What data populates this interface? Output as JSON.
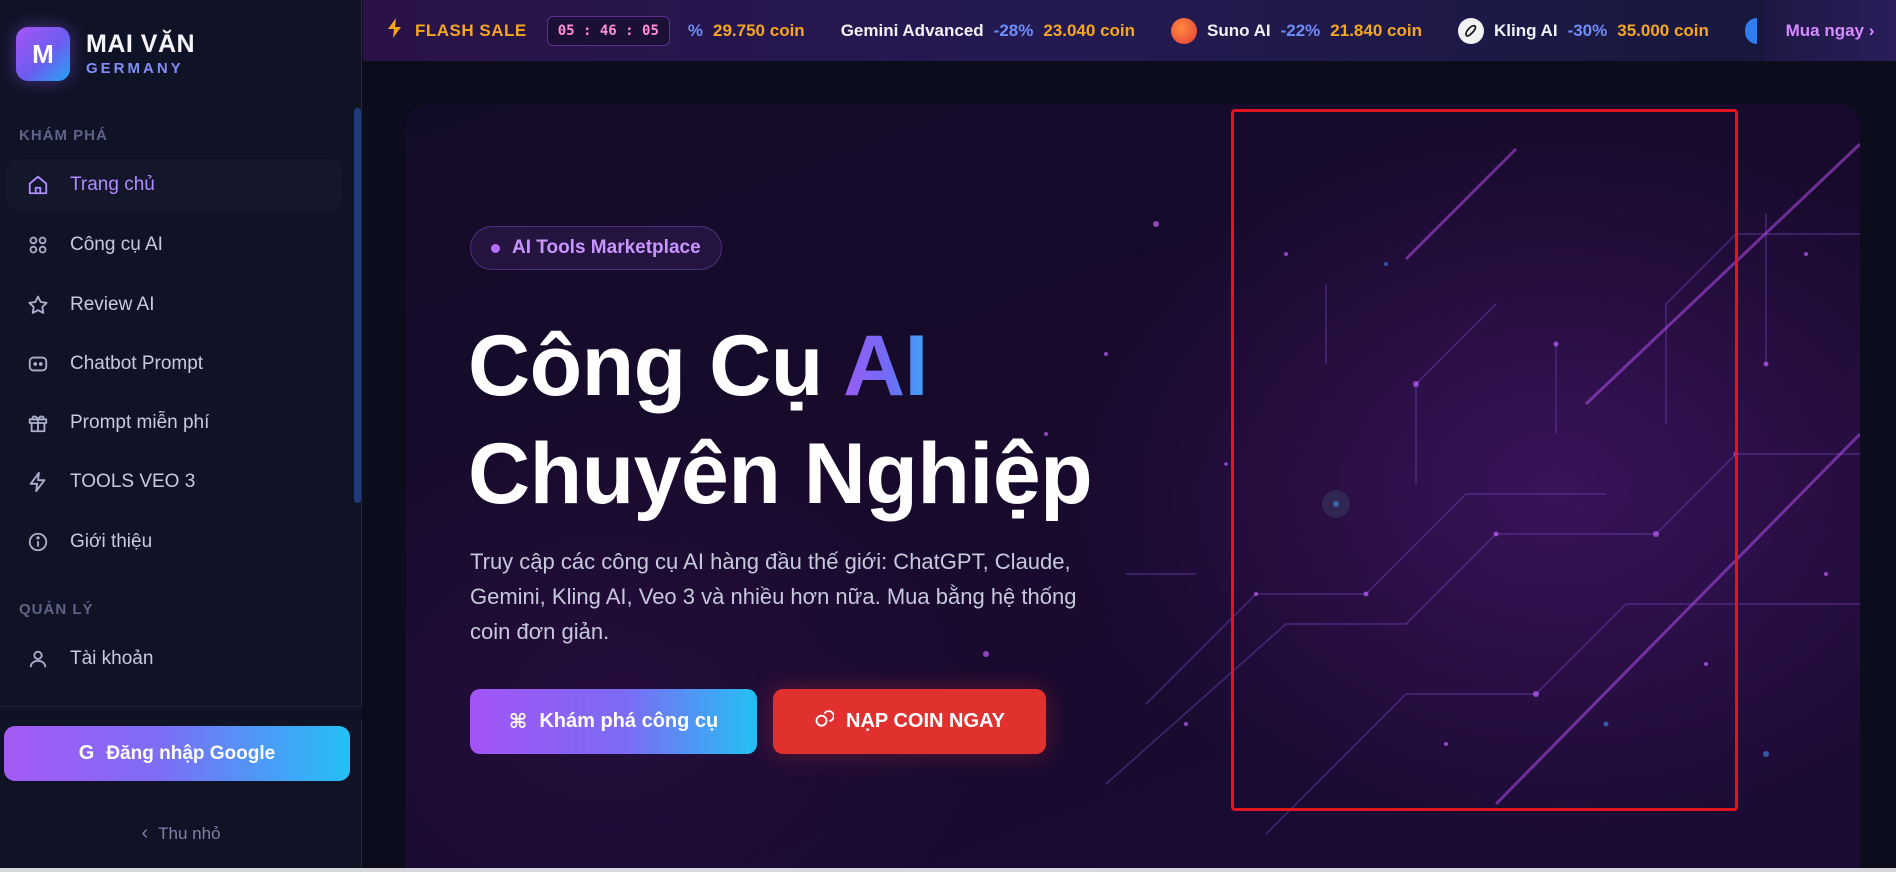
{
  "brand": {
    "logo_letter": "M",
    "name": "MAI VĂN",
    "subtitle": "GERMANY"
  },
  "sidebar": {
    "section_explore": "KHÁM PHÁ",
    "items": [
      {
        "label": "Trang chủ",
        "icon": "home-icon",
        "active": true
      },
      {
        "label": "Công cụ AI",
        "icon": "grid-icon"
      },
      {
        "label": "Review AI",
        "icon": "star-icon"
      },
      {
        "label": "Chatbot Prompt",
        "icon": "chatbot-icon"
      },
      {
        "label": "Prompt miễn phí",
        "icon": "gift-icon"
      },
      {
        "label": "TOOLS VEO 3",
        "icon": "bolt-icon"
      },
      {
        "label": "Giới thiệu",
        "icon": "info-icon"
      }
    ],
    "section_manage": "QUẢN LÝ",
    "manage_items": [
      {
        "label": "Tài khoản",
        "icon": "user-icon"
      }
    ],
    "login_label": "Đăng nhập Google",
    "collapse_label": "Thu nhỏ"
  },
  "ticker": {
    "flash_label": "FLASH SALE",
    "timer": "05 : 46 : 05",
    "partial_item": {
      "discount": "%",
      "price": "29.750 coin"
    },
    "items": [
      {
        "name": "Gemini Advanced",
        "discount": "-28%",
        "price": "23.040 coin",
        "logo": "none"
      },
      {
        "name": "Suno AI",
        "discount": "-22%",
        "price": "21.840 coin",
        "logo": "suno-logo-icon"
      },
      {
        "name": "Kling AI",
        "discount": "-30%",
        "price": "35.000 coin",
        "logo": "kling-logo-icon"
      }
    ],
    "buy_label": "Mua ngay ›"
  },
  "hero": {
    "badge": "AI Tools Marketplace",
    "headline_part1": "Công Cụ ",
    "headline_accent": "AI",
    "headline_line2": "Chuyên Nghiệp",
    "description": "Truy cập các công cụ AI hàng đầu thế giới: ChatGPT, Claude, Gemini, Kling AI, Veo 3 và nhiều hơn nữa. Mua bằng hệ thống coin đơn giản.",
    "explore_button": "Khám phá công cụ",
    "coin_button": "NẠP COIN NGAY"
  },
  "colors": {
    "accent_purple": "#a855f7",
    "accent_blue": "#22c1f4",
    "flash_orange": "#f5a623",
    "discount_blue": "#6e8df8",
    "coin_red": "#e0312f",
    "selection_red": "#e0161c"
  }
}
